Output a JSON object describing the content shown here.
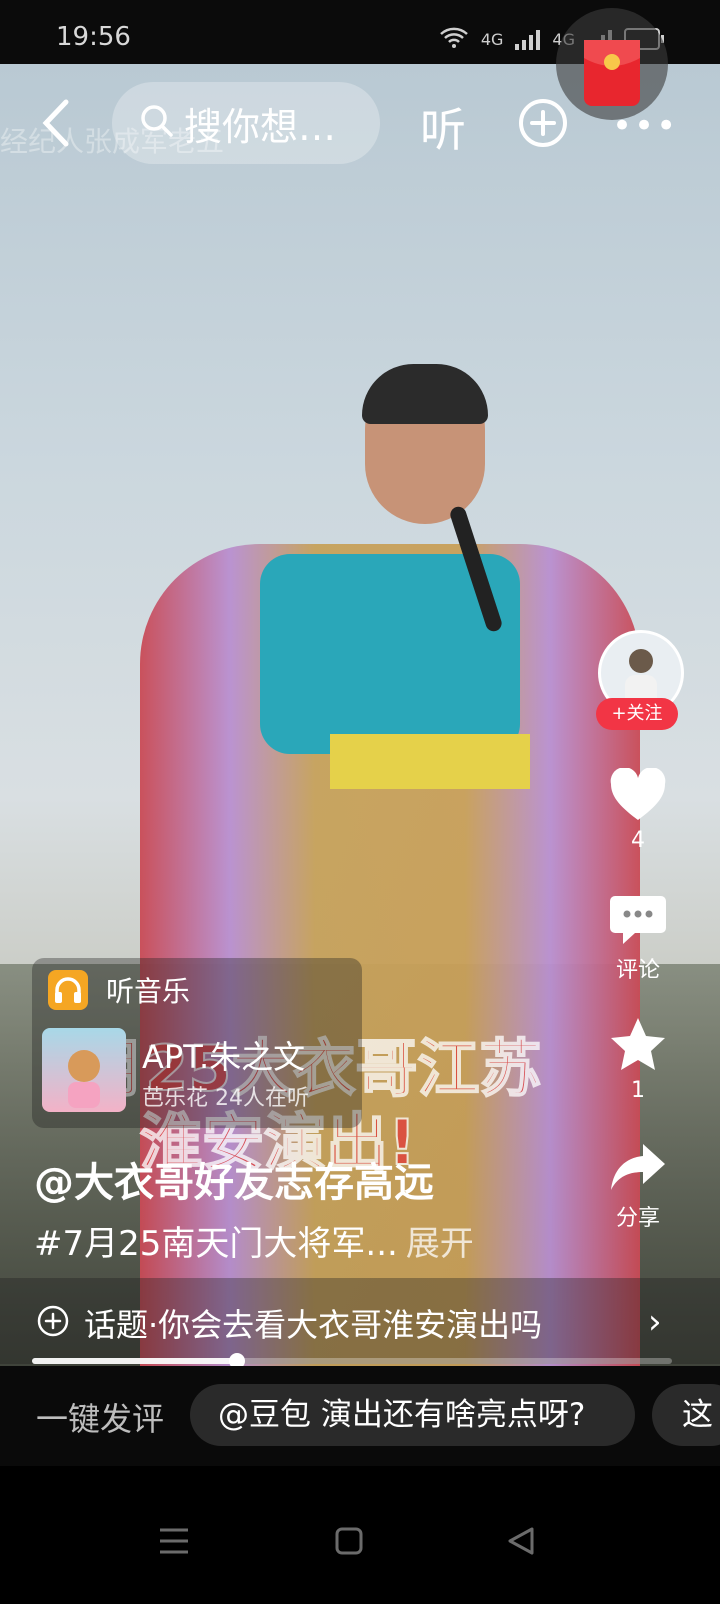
{
  "status_bar": {
    "time": "19:56",
    "network_1": "4G",
    "network_2": "4G",
    "battery": "99"
  },
  "top_bar": {
    "faded_caption": "经纪人张成军老五",
    "search_placeholder": "搜你想…",
    "listen_label": "听",
    "back_icon": "chevron-left-icon",
    "add_icon": "plus-circle-icon",
    "more_icon": "more-icon",
    "red_packet_icon": "red-packet-icon"
  },
  "video": {
    "overlay_title_line1": "7月25大衣哥江苏",
    "overlay_title_line2": "淮安演出!"
  },
  "side_actions": {
    "follow_label": "+关注",
    "like_count": "4",
    "comment_label": "评论",
    "favorite_count": "1",
    "share_label": "分享"
  },
  "music_card": {
    "label": "听音乐",
    "song": "APT.朱之文",
    "listeners": "芭乐花 24人在听"
  },
  "post": {
    "author": "@大衣哥好友志存高远",
    "description": "#7月25南天门大将军...",
    "expand_label": "展开"
  },
  "topic": {
    "text": "话题·你会去看大衣哥淮安演出吗"
  },
  "progress": {
    "fraction": 0.32
  },
  "comment_bar": {
    "quick_label": "一键发评",
    "suggestion_1": "@豆包 演出还有啥亮点呀?",
    "suggestion_2": "这"
  },
  "colors": {
    "follow_red": "#f23545",
    "overlay_red": "#e23a3a",
    "music_badge": "#f5a623"
  }
}
